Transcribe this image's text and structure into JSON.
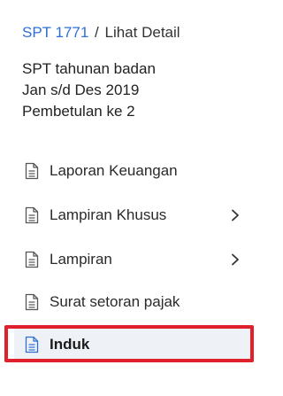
{
  "breadcrumb": {
    "link_label": "SPT 1771",
    "separator": "/",
    "current_label": "Lihat Detail"
  },
  "summary": {
    "line1": "SPT tahunan badan",
    "line2": "Jan s/d Des 2019",
    "line3": "Pembetulan ke 2"
  },
  "menu": {
    "items": [
      {
        "label": "Laporan Keuangan",
        "icon": "document-icon",
        "has_chevron": false
      },
      {
        "label": "Lampiran Khusus",
        "icon": "document-icon",
        "has_chevron": true
      },
      {
        "label": "Lampiran",
        "icon": "document-icon",
        "has_chevron": true
      },
      {
        "label": "Surat setoran pajak",
        "icon": "document-icon",
        "has_chevron": false
      },
      {
        "label": "Induk",
        "icon": "document-icon",
        "has_chevron": false,
        "active": true
      }
    ]
  },
  "colors": {
    "link": "#2f6fd6",
    "active_bg": "#eef1f6",
    "highlight_border": "#e0202a",
    "active_icon": "#2f6fd6"
  }
}
